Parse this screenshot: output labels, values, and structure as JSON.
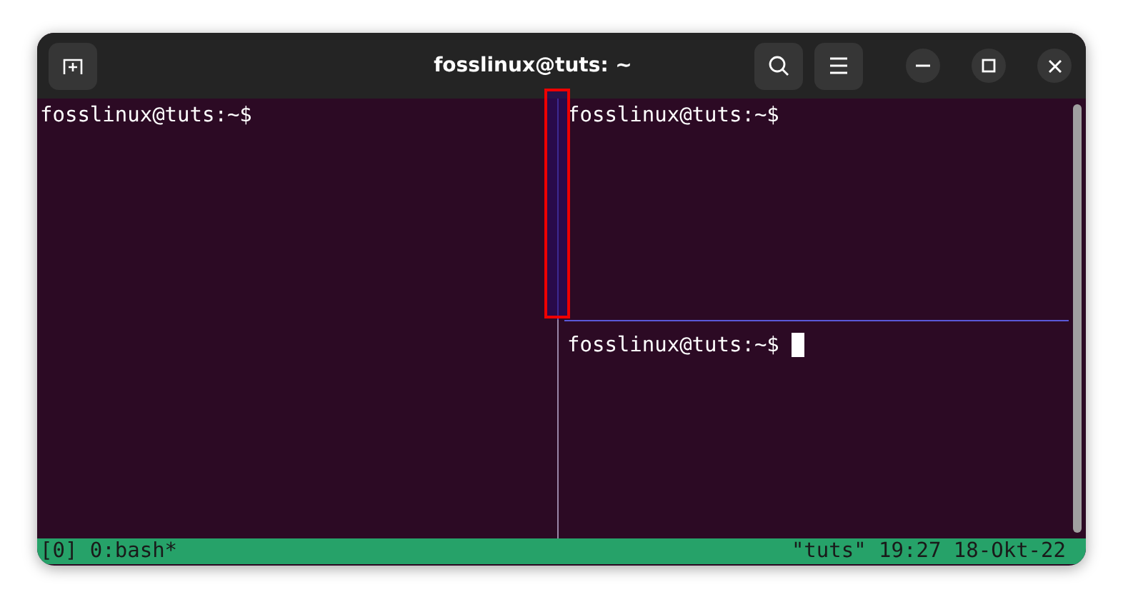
{
  "window": {
    "title": "fosslinux@tuts: ~"
  },
  "panes": [
    {
      "prompt": "fosslinux@tuts:~$",
      "cursor": false
    },
    {
      "prompt": "fosslinux@tuts:~$",
      "cursor": false
    },
    {
      "prompt": "fosslinux@tuts:~$",
      "cursor": true
    }
  ],
  "status_bar": {
    "left": "[0] 0:bash*",
    "right": "\"tuts\" 19:27 18-Okt-22"
  }
}
